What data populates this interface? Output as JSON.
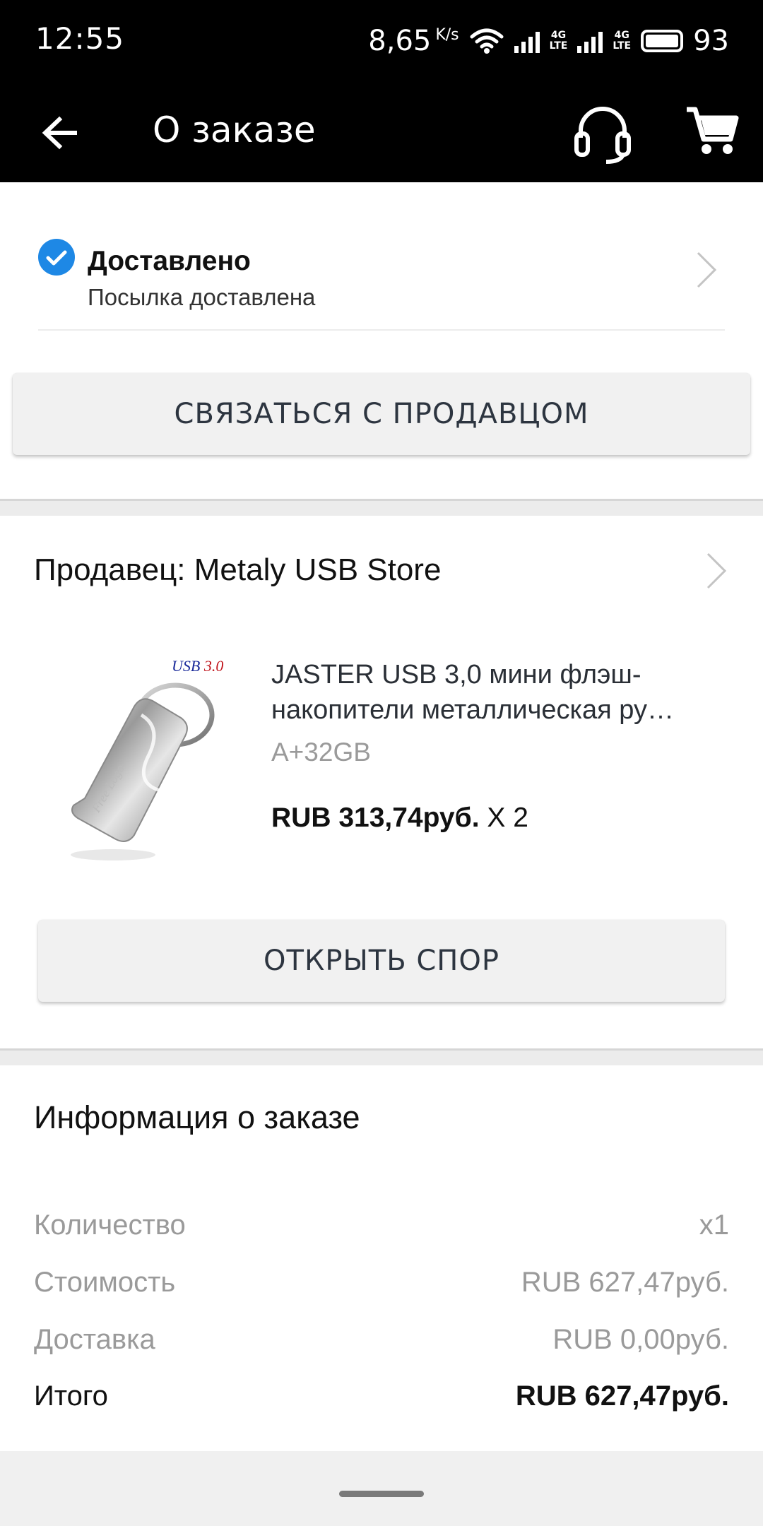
{
  "status_bar": {
    "time": "12:55",
    "net_speed": "8,65",
    "net_unit": "K/s",
    "lte1": "4G",
    "lte1_sub": "LTE",
    "lte2": "4G",
    "lte2_sub": "LTE",
    "battery": "93"
  },
  "app_bar": {
    "title": "О заказе",
    "back_icon": "arrow-left-icon",
    "support_icon": "headset-icon",
    "cart_icon": "cart-icon"
  },
  "order_status": {
    "title": "Доставлено",
    "subtitle": "Посылка доставлена",
    "icon": "check-circle-icon",
    "accent": "#1e88e5"
  },
  "contact_button": "СВЯЗАТЬСЯ С ПРОДАВЦОМ",
  "seller": {
    "label": "Продавец: Metaly USB Store"
  },
  "product": {
    "title_line1": "JASTER USB 3,0 мини флэш-",
    "title_line2": "накопители металлическая ру…",
    "variant": "A+32GB",
    "price": "RUB 313,74руб.",
    "quantity": "X 2",
    "image_badge": "USB 3.0"
  },
  "dispute_button": "ОТКРЫТЬ СПОР",
  "order_info": {
    "title": "Информация о заказе",
    "rows": [
      {
        "label": "Количество",
        "value": "x1"
      },
      {
        "label": "Стоимость",
        "value": "RUB 627,47руб."
      },
      {
        "label": "Доставка",
        "value": "RUB 0,00руб."
      },
      {
        "label": "Итого",
        "value": "RUB 627,47руб."
      }
    ]
  }
}
